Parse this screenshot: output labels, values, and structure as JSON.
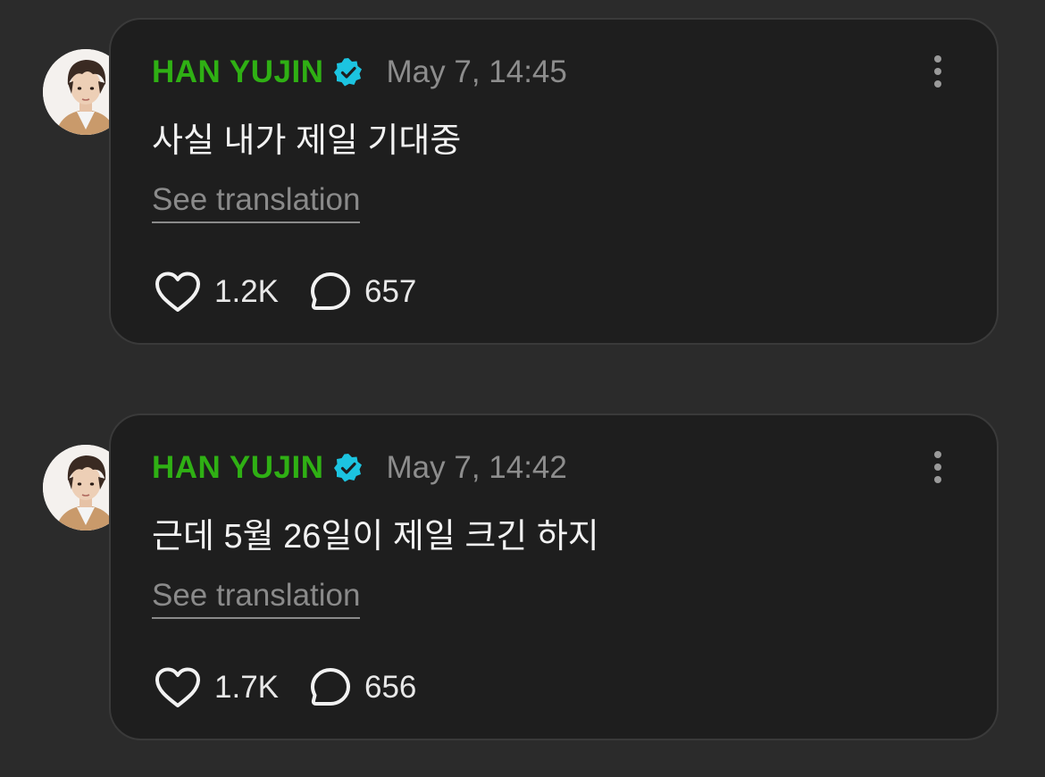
{
  "colors": {
    "background": "#2b2b2b",
    "card": "#1e1e1e",
    "name": "#2fb014",
    "verified_badge": "#1cc4e0",
    "muted": "#8d8d8d",
    "text": "#f2f2f2"
  },
  "icons": {
    "verified": "verified-badge-icon",
    "more": "more-vertical-icon",
    "like": "heart-icon",
    "comment": "comment-bubble-icon"
  },
  "posts": [
    {
      "author": "HAN YUJIN",
      "timestamp": "May 7, 14:45",
      "message": "사실 내가 제일 기대중",
      "translate_label": "See translation",
      "likes": "1.2K",
      "comments": "657"
    },
    {
      "author": "HAN YUJIN",
      "timestamp": "May 7, 14:42",
      "message": "근데 5월 26일이 제일 크긴 하지",
      "translate_label": "See translation",
      "likes": "1.7K",
      "comments": "656"
    }
  ]
}
